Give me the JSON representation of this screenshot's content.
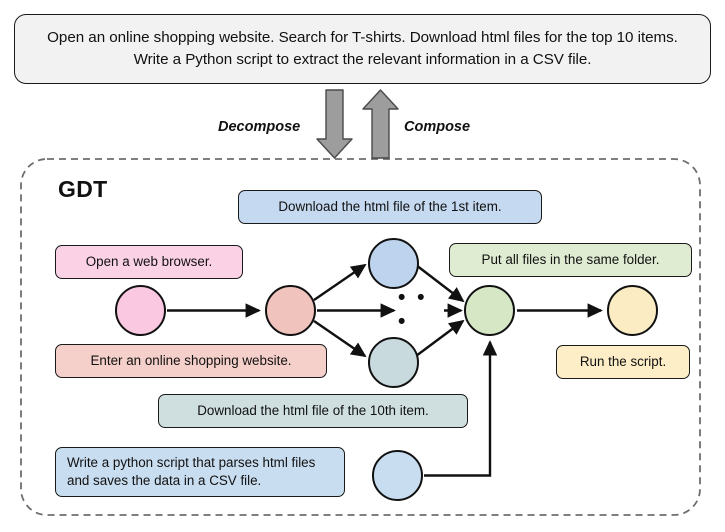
{
  "task": {
    "text": "Open an online shopping website. Search for T-shirts. Download html files for the top 10 items. Write a Python script to extract the relevant information in a CSV file."
  },
  "flow": {
    "decompose_label": "Decompose",
    "compose_label": "Compose",
    "decompose_arrow_direction": "down",
    "compose_arrow_direction": "up",
    "arrow_color": "#8c8c8c"
  },
  "graph": {
    "title": "GDT",
    "ellipsis": "• • •",
    "nodes": [
      {
        "id": "start",
        "label": "Open a web browser.",
        "color": "#fbc8e2"
      },
      {
        "id": "enter",
        "label": "Enter an online shopping website.",
        "color": "#f0c3bc"
      },
      {
        "id": "branch-top",
        "label": "Download the html file of the 1st item.",
        "color": "#bed3ee"
      },
      {
        "id": "branch-bot",
        "label": "Download the html file of the 10th item.",
        "color": "#c8dade"
      },
      {
        "id": "merge",
        "label": "Put all files in the same folder.",
        "color": "#d6e7c6"
      },
      {
        "id": "end",
        "label": "Run the script.",
        "color": "#fcecc4"
      },
      {
        "id": "script",
        "label": "Write a python script that parses html files and saves the data in a CSV file.",
        "color": "#c9ddf0"
      }
    ],
    "notes": {
      "open_browser": "Open a web browser.",
      "enter_site": "Enter an online shopping website.",
      "download_first": "Download the html file of the 1st item.",
      "download_tenth": "Download the html file of the 10th item.",
      "put_files": "Put all files in the same folder.",
      "run_script": "Run the script.",
      "write_script": "Write a python script that parses html files and saves the data in a CSV file."
    }
  }
}
